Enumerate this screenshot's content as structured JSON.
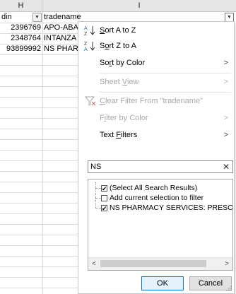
{
  "sheet": {
    "columns": [
      {
        "label": "H"
      },
      {
        "label": "I"
      }
    ],
    "header_row": {
      "din": "din",
      "tradename": "tradename"
    },
    "rows": [
      {
        "din": "2396769",
        "tradename": "APO-ABA"
      },
      {
        "din": "2348764",
        "tradename": "INTANZA"
      },
      {
        "din": "93899992",
        "tradename": "NS PHAR"
      }
    ]
  },
  "menu": {
    "sort_az": "Sort A to Z",
    "sort_za": "Sort Z to A",
    "sort_by_color": "Sort by Color",
    "sheet_view": "Sheet View",
    "clear_filter": "Clear Filter From \"tradename\"",
    "filter_by_color": "Filter by Color",
    "text_filters": "Text Filters",
    "search_value": "NS",
    "list": [
      {
        "label": "(Select All Search Results)",
        "checked": true
      },
      {
        "label": "Add current selection to filter",
        "checked": false
      },
      {
        "label": "NS PHARMACY SERVICES: PRESCRIP",
        "checked": true
      }
    ],
    "ok": "OK",
    "cancel": "Cancel"
  }
}
